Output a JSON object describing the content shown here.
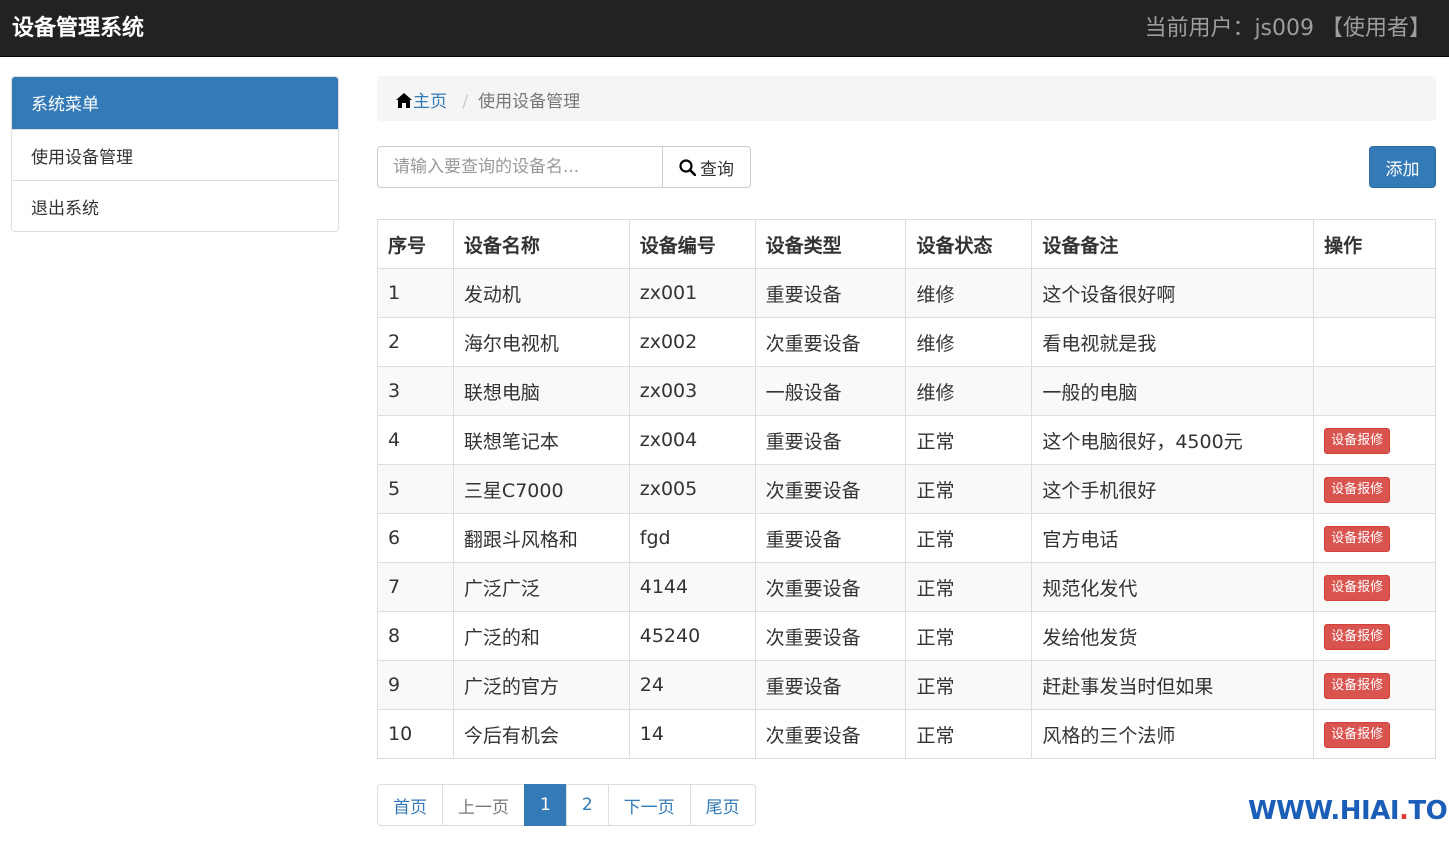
{
  "header": {
    "title": "设备管理系统",
    "user_text": "当前用户：js009 【使用者】"
  },
  "sidebar": {
    "title": "系统菜单",
    "items": [
      {
        "label": "使用设备管理"
      },
      {
        "label": "退出系统"
      }
    ]
  },
  "breadcrumb": {
    "home": "主页",
    "current": "使用设备管理"
  },
  "search": {
    "placeholder": "请输入要查询的设备名...",
    "button_label": "查询"
  },
  "add_button": "添加",
  "table": {
    "headers": [
      "序号",
      "设备名称",
      "设备编号",
      "设备类型",
      "设备状态",
      "设备备注",
      "操作"
    ],
    "rows": [
      {
        "id": "1",
        "name": "发动机",
        "code": "zx001",
        "type": "重要设备",
        "status": "维修",
        "note": "这个设备很好啊",
        "action": ""
      },
      {
        "id": "2",
        "name": "海尔电视机",
        "code": "zx002",
        "type": "次重要设备",
        "status": "维修",
        "note": "看电视就是我",
        "action": ""
      },
      {
        "id": "3",
        "name": "联想电脑",
        "code": "zx003",
        "type": "一般设备",
        "status": "维修",
        "note": "一般的电脑",
        "action": ""
      },
      {
        "id": "4",
        "name": "联想笔记本",
        "code": "zx004",
        "type": "重要设备",
        "status": "正常",
        "note": "这个电脑很好，4500元",
        "action": "设备报修"
      },
      {
        "id": "5",
        "name": "三星C7000",
        "code": "zx005",
        "type": "次重要设备",
        "status": "正常",
        "note": "这个手机很好",
        "action": "设备报修"
      },
      {
        "id": "6",
        "name": "翻跟斗风格和",
        "code": "fgd",
        "type": "重要设备",
        "status": "正常",
        "note": "官方电话",
        "action": "设备报修"
      },
      {
        "id": "7",
        "name": "广泛广泛",
        "code": "4144",
        "type": "次重要设备",
        "status": "正常",
        "note": "规范化发代",
        "action": "设备报修"
      },
      {
        "id": "8",
        "name": "广泛的和",
        "code": "45240",
        "type": "次重要设备",
        "status": "正常",
        "note": "发给他发货",
        "action": "设备报修"
      },
      {
        "id": "9",
        "name": "广泛的官方",
        "code": "24",
        "type": "重要设备",
        "status": "正常",
        "note": "赶赴事发当时但如果",
        "action": "设备报修"
      },
      {
        "id": "10",
        "name": "今后有机会",
        "code": "14",
        "type": "次重要设备",
        "status": "正常",
        "note": "风格的三个法师",
        "action": "设备报修"
      }
    ]
  },
  "pagination": {
    "first": "首页",
    "prev": "上一页",
    "pages": [
      "1",
      "2"
    ],
    "active": "1",
    "next": "下一页",
    "last": "尾页"
  },
  "watermark": {
    "main": "WWW.HIAI",
    "dot": ".",
    "tld": "TOP"
  },
  "colors": {
    "primary": "#337ab7",
    "danger": "#d9534f",
    "navbar": "#222222"
  }
}
